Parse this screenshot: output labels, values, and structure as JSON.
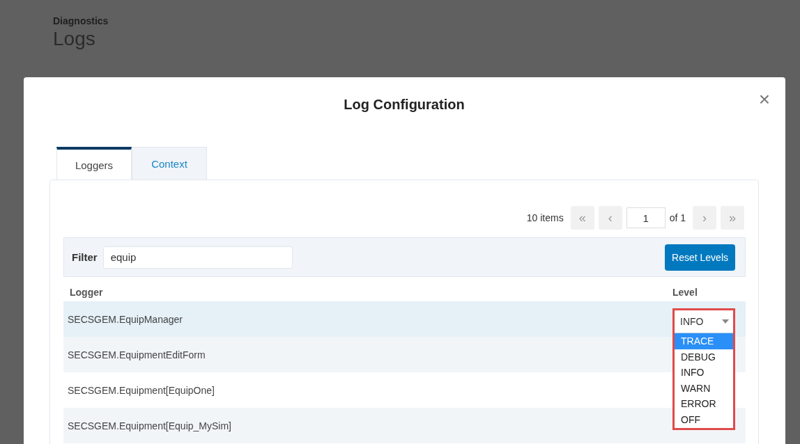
{
  "page": {
    "breadcrumb": "Diagnostics",
    "title": "Logs"
  },
  "dialog": {
    "title": "Log Configuration",
    "close": "×",
    "tabs": [
      {
        "label": "Loggers",
        "selected": true
      },
      {
        "label": "Context",
        "selected": false
      }
    ],
    "pager": {
      "count": "10 items",
      "first": "«",
      "prev": "‹",
      "page": "1",
      "of": "of 1",
      "next": "›",
      "last": "»"
    },
    "filter": {
      "label": "Filter",
      "value": "equip"
    },
    "reset_button": "Reset Levels",
    "table": {
      "columns": [
        "Logger",
        "Level"
      ],
      "rows": [
        {
          "logger": "SECSGEM.EquipManager",
          "hovered": true
        },
        {
          "logger": "SECSGEM.EquipmentEditForm",
          "hovered": false
        },
        {
          "logger": "SECSGEM.Equipment[EquipOne]",
          "hovered": false
        },
        {
          "logger": "SECSGEM.Equipment[Equip_MySim]",
          "hovered": false
        }
      ]
    },
    "level_select": {
      "value": "INFO",
      "highlighted": true,
      "options": [
        {
          "label": "TRACE",
          "hovered": true
        },
        {
          "label": "DEBUG",
          "hovered": false
        },
        {
          "label": "INFO",
          "hovered": false
        },
        {
          "label": "WARN",
          "hovered": false
        },
        {
          "label": "ERROR",
          "hovered": false
        },
        {
          "label": "OFF",
          "hovered": false
        }
      ]
    }
  }
}
